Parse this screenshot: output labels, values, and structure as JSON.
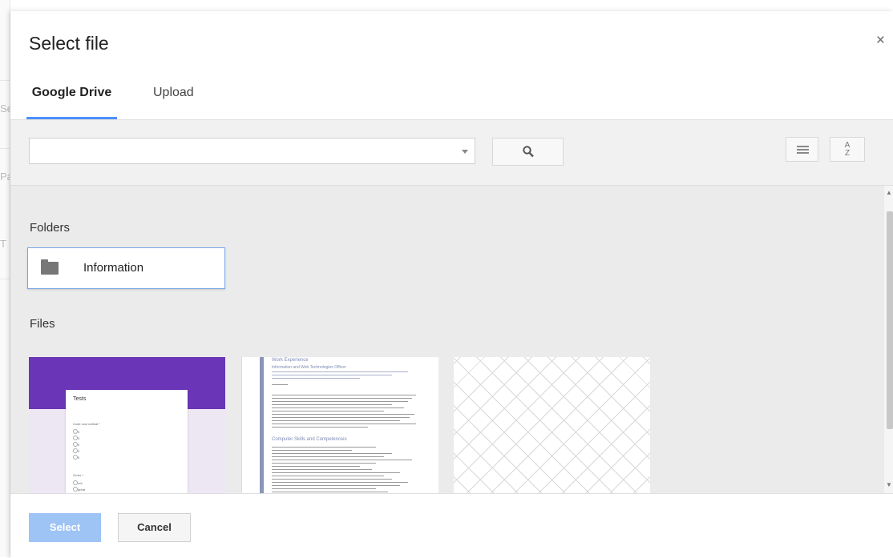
{
  "background_page": {
    "glyphs": [
      "Se",
      "Pa",
      "T"
    ]
  },
  "dialog": {
    "title": "Select file",
    "close_icon": "close-icon",
    "close_glyph": "×"
  },
  "tabs": [
    {
      "label": "Google Drive",
      "active": true
    },
    {
      "label": "Upload",
      "active": false
    }
  ],
  "search": {
    "value": "",
    "placeholder": "",
    "search_icon": "search-icon",
    "list_view_icon": "list-view-icon",
    "sort_icon": "sort-az-icon",
    "sort_glyph_top": "A",
    "sort_glyph_bottom": "Z"
  },
  "sections": {
    "folders_label": "Folders",
    "files_label": "Files"
  },
  "folders": [
    {
      "name": "Information",
      "icon": "folder-icon"
    }
  ],
  "files": [
    {
      "kind": "form-thumbnail",
      "form_title": "Tests",
      "question_lines": [
        "Code cool ordinal *",
        "0",
        "0",
        "0",
        "0",
        "0",
        "Order *",
        "not",
        "great",
        "time"
      ]
    },
    {
      "kind": "document-thumbnail",
      "headings": [
        "Work Experience",
        "Information and Web Technologies Officer",
        "Computer Skills and Competencies"
      ]
    },
    {
      "kind": "blank-thumbnail"
    }
  ],
  "footer": {
    "select_label": "Select",
    "cancel_label": "Cancel"
  },
  "colors": {
    "accent": "#4d90fe",
    "select_button": "#9ec3f5",
    "form_header": "#6a35b6",
    "content_bg": "#ebebeb"
  }
}
